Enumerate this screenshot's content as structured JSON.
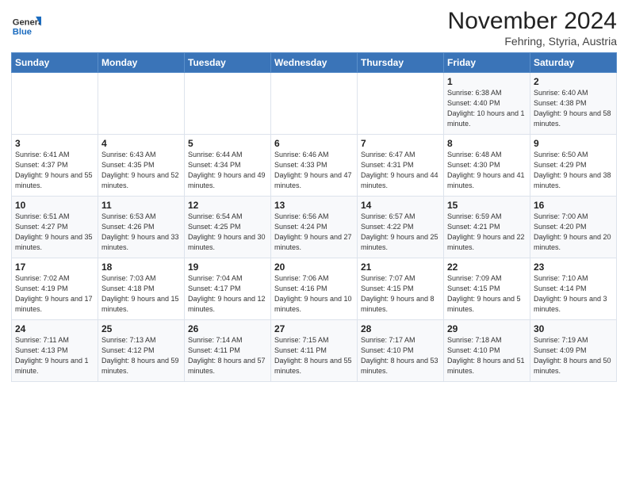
{
  "logo": {
    "general": "General",
    "blue": "Blue"
  },
  "header": {
    "month": "November 2024",
    "location": "Fehring, Styria, Austria"
  },
  "days_of_week": [
    "Sunday",
    "Monday",
    "Tuesday",
    "Wednesday",
    "Thursday",
    "Friday",
    "Saturday"
  ],
  "weeks": [
    [
      {
        "day": "",
        "info": ""
      },
      {
        "day": "",
        "info": ""
      },
      {
        "day": "",
        "info": ""
      },
      {
        "day": "",
        "info": ""
      },
      {
        "day": "",
        "info": ""
      },
      {
        "day": "1",
        "info": "Sunrise: 6:38 AM\nSunset: 4:40 PM\nDaylight: 10 hours and 1 minute."
      },
      {
        "day": "2",
        "info": "Sunrise: 6:40 AM\nSunset: 4:38 PM\nDaylight: 9 hours and 58 minutes."
      }
    ],
    [
      {
        "day": "3",
        "info": "Sunrise: 6:41 AM\nSunset: 4:37 PM\nDaylight: 9 hours and 55 minutes."
      },
      {
        "day": "4",
        "info": "Sunrise: 6:43 AM\nSunset: 4:35 PM\nDaylight: 9 hours and 52 minutes."
      },
      {
        "day": "5",
        "info": "Sunrise: 6:44 AM\nSunset: 4:34 PM\nDaylight: 9 hours and 49 minutes."
      },
      {
        "day": "6",
        "info": "Sunrise: 6:46 AM\nSunset: 4:33 PM\nDaylight: 9 hours and 47 minutes."
      },
      {
        "day": "7",
        "info": "Sunrise: 6:47 AM\nSunset: 4:31 PM\nDaylight: 9 hours and 44 minutes."
      },
      {
        "day": "8",
        "info": "Sunrise: 6:48 AM\nSunset: 4:30 PM\nDaylight: 9 hours and 41 minutes."
      },
      {
        "day": "9",
        "info": "Sunrise: 6:50 AM\nSunset: 4:29 PM\nDaylight: 9 hours and 38 minutes."
      }
    ],
    [
      {
        "day": "10",
        "info": "Sunrise: 6:51 AM\nSunset: 4:27 PM\nDaylight: 9 hours and 35 minutes."
      },
      {
        "day": "11",
        "info": "Sunrise: 6:53 AM\nSunset: 4:26 PM\nDaylight: 9 hours and 33 minutes."
      },
      {
        "day": "12",
        "info": "Sunrise: 6:54 AM\nSunset: 4:25 PM\nDaylight: 9 hours and 30 minutes."
      },
      {
        "day": "13",
        "info": "Sunrise: 6:56 AM\nSunset: 4:24 PM\nDaylight: 9 hours and 27 minutes."
      },
      {
        "day": "14",
        "info": "Sunrise: 6:57 AM\nSunset: 4:22 PM\nDaylight: 9 hours and 25 minutes."
      },
      {
        "day": "15",
        "info": "Sunrise: 6:59 AM\nSunset: 4:21 PM\nDaylight: 9 hours and 22 minutes."
      },
      {
        "day": "16",
        "info": "Sunrise: 7:00 AM\nSunset: 4:20 PM\nDaylight: 9 hours and 20 minutes."
      }
    ],
    [
      {
        "day": "17",
        "info": "Sunrise: 7:02 AM\nSunset: 4:19 PM\nDaylight: 9 hours and 17 minutes."
      },
      {
        "day": "18",
        "info": "Sunrise: 7:03 AM\nSunset: 4:18 PM\nDaylight: 9 hours and 15 minutes."
      },
      {
        "day": "19",
        "info": "Sunrise: 7:04 AM\nSunset: 4:17 PM\nDaylight: 9 hours and 12 minutes."
      },
      {
        "day": "20",
        "info": "Sunrise: 7:06 AM\nSunset: 4:16 PM\nDaylight: 9 hours and 10 minutes."
      },
      {
        "day": "21",
        "info": "Sunrise: 7:07 AM\nSunset: 4:15 PM\nDaylight: 9 hours and 8 minutes."
      },
      {
        "day": "22",
        "info": "Sunrise: 7:09 AM\nSunset: 4:15 PM\nDaylight: 9 hours and 5 minutes."
      },
      {
        "day": "23",
        "info": "Sunrise: 7:10 AM\nSunset: 4:14 PM\nDaylight: 9 hours and 3 minutes."
      }
    ],
    [
      {
        "day": "24",
        "info": "Sunrise: 7:11 AM\nSunset: 4:13 PM\nDaylight: 9 hours and 1 minute."
      },
      {
        "day": "25",
        "info": "Sunrise: 7:13 AM\nSunset: 4:12 PM\nDaylight: 8 hours and 59 minutes."
      },
      {
        "day": "26",
        "info": "Sunrise: 7:14 AM\nSunset: 4:11 PM\nDaylight: 8 hours and 57 minutes."
      },
      {
        "day": "27",
        "info": "Sunrise: 7:15 AM\nSunset: 4:11 PM\nDaylight: 8 hours and 55 minutes."
      },
      {
        "day": "28",
        "info": "Sunrise: 7:17 AM\nSunset: 4:10 PM\nDaylight: 8 hours and 53 minutes."
      },
      {
        "day": "29",
        "info": "Sunrise: 7:18 AM\nSunset: 4:10 PM\nDaylight: 8 hours and 51 minutes."
      },
      {
        "day": "30",
        "info": "Sunrise: 7:19 AM\nSunset: 4:09 PM\nDaylight: 8 hours and 50 minutes."
      }
    ]
  ]
}
